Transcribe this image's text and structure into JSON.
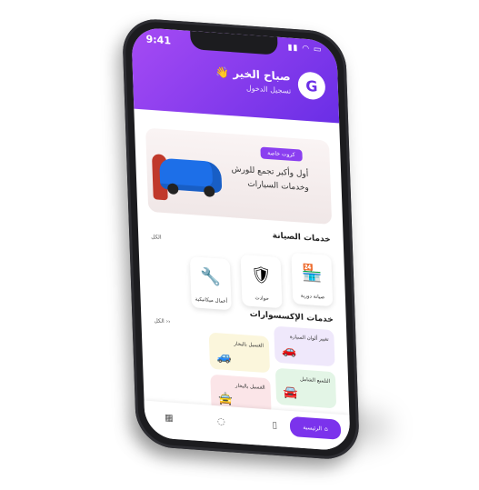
{
  "status": {
    "time": "9:41",
    "icons": "▮▮ ◠ ▭"
  },
  "header": {
    "logo": "G",
    "greeting": "صباح الخير 👋",
    "login": "تسجيل الدخول"
  },
  "banner": {
    "tag": "كروت خاصة",
    "text": "أول وأكبر تجمع للورش وخدمات السيارات"
  },
  "maintenance": {
    "title": "خدمات الصيانة",
    "more": "الكل",
    "items": [
      {
        "label": "صيانة دورية",
        "icon": "garage-icon"
      },
      {
        "label": "حوادث",
        "icon": "shield-car-icon"
      },
      {
        "label": "أعمال ميكانيكية",
        "icon": "wrench-icon"
      }
    ]
  },
  "accessories": {
    "title": "خدمات الإكسسوارات",
    "more": "الكل ››",
    "items": [
      {
        "label": "تغيير ألوان السيارة",
        "color": "#efe8fb",
        "icon": "car-paint-icon"
      },
      {
        "label": "الغسيل بالبخار",
        "color": "#fbf6dc",
        "icon": "car-wash-icon"
      },
      {
        "label": "التلميع الشامل",
        "color": "#e3f5e6",
        "icon": "car-polish-icon"
      },
      {
        "label": "الغسيل بالبخار",
        "color": "#fbe5e8",
        "icon": "car-steam-icon"
      }
    ]
  },
  "tabbar": {
    "active_label": "الرئيسية"
  },
  "colors": {
    "primary": "#7b33ec",
    "header_start": "#a64bf4"
  }
}
